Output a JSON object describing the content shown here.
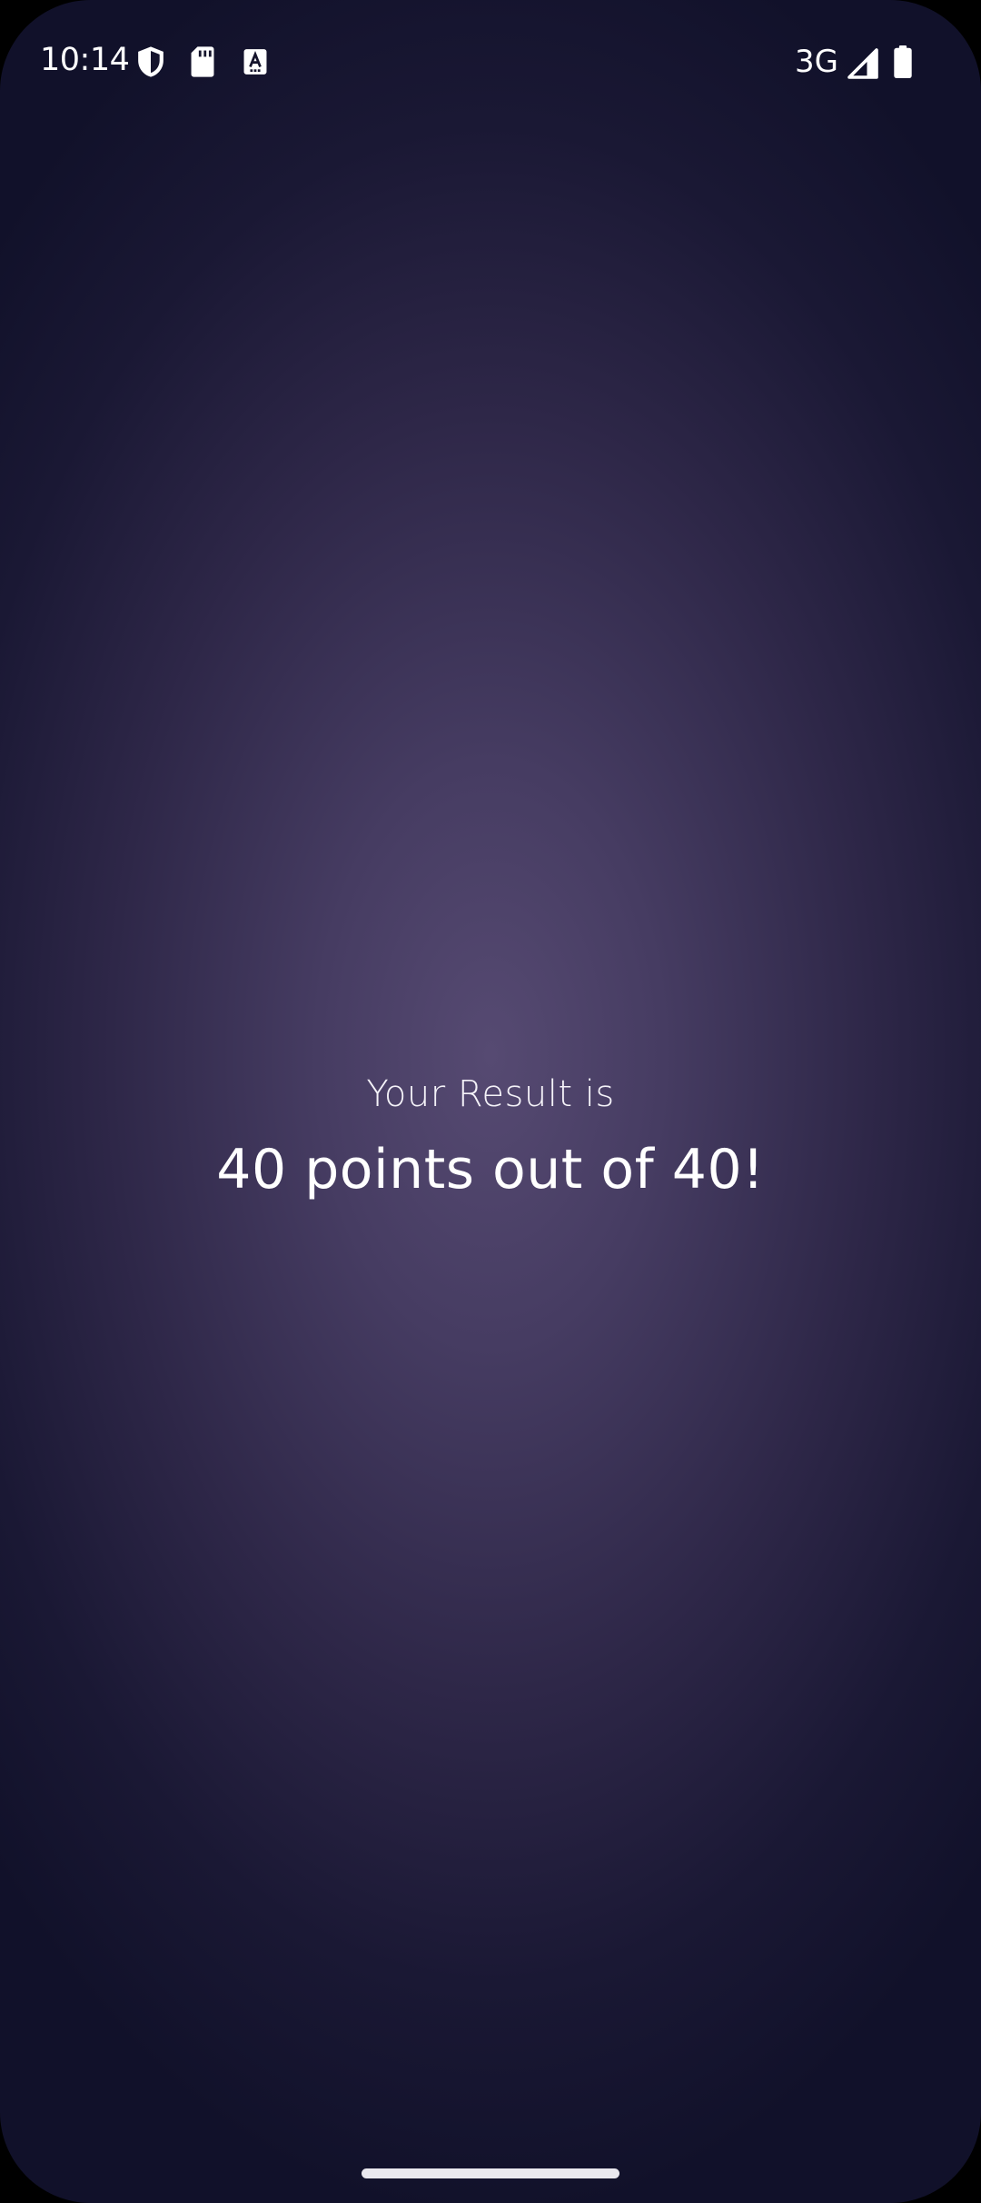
{
  "status_bar": {
    "time": "10:14",
    "network_type": "3G",
    "icons": [
      "shield-icon",
      "sd-card-icon",
      "font-download-icon",
      "signal-icon",
      "battery-icon"
    ]
  },
  "result": {
    "caption": "Your Result is",
    "score_text": "40 points out of 40!",
    "points": 40,
    "max_points": 40
  },
  "colors": {
    "background_center": "#564a72",
    "background_edge": "#11112a",
    "text": "#ffffff"
  }
}
